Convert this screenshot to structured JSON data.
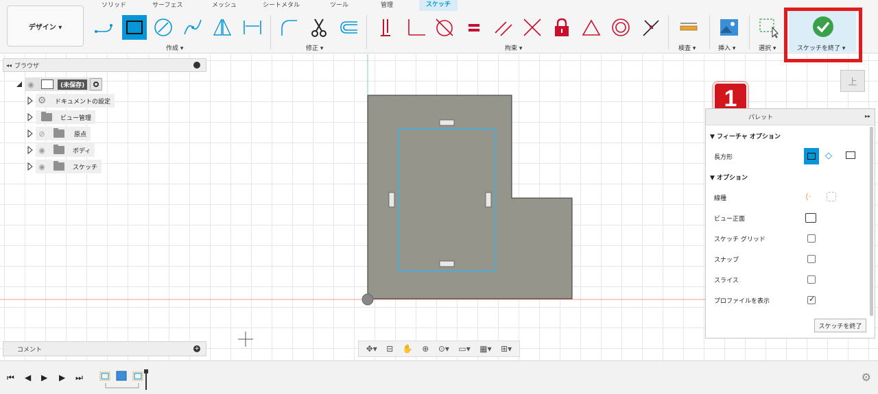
{
  "workspace": {
    "label": "デザイン ▾"
  },
  "tabs": [
    "ソリッド",
    "サーフェス",
    "メッシュ",
    "シートメタル",
    "ツール",
    "管理",
    "スケッチ"
  ],
  "active_tab": "スケッチ",
  "groups": {
    "create": "作成 ▾",
    "modify": "修正 ▾",
    "constraints": "拘束 ▾",
    "inspect": "検査 ▾",
    "insert": "挿入 ▾",
    "select": "選択 ▾",
    "finish": "スケッチを終了 ▾"
  },
  "callout": {
    "number": "1"
  },
  "browser": {
    "title": "ブラウザ",
    "root": "(未保存)",
    "items": [
      {
        "label": "ドキュメントの設定"
      },
      {
        "label": "ビュー管理"
      },
      {
        "label": "原点"
      },
      {
        "label": "ボディ"
      },
      {
        "label": "スケッチ"
      }
    ]
  },
  "comment": {
    "label": "コメント"
  },
  "viewcube": {
    "label": "上"
  },
  "palette": {
    "title": "パレット",
    "section1": "▼ フィーチャ オプション",
    "rect_label": "長方形",
    "section2": "▼ オプション",
    "rows": [
      {
        "label": "線種"
      },
      {
        "label": "ビュー正面"
      },
      {
        "label": "スケッチ グリッド",
        "checked": false
      },
      {
        "label": "スナップ",
        "checked": false
      },
      {
        "label": "スライス",
        "checked": false
      },
      {
        "label": "プロファイルを表示",
        "checked": true
      }
    ],
    "finish_button": "スケッチを終了"
  },
  "colors": {
    "accent": "#0696d7",
    "callout_red": "#d1151d",
    "finish_green": "#3aa14b",
    "sketch_fill": "#95958b"
  }
}
